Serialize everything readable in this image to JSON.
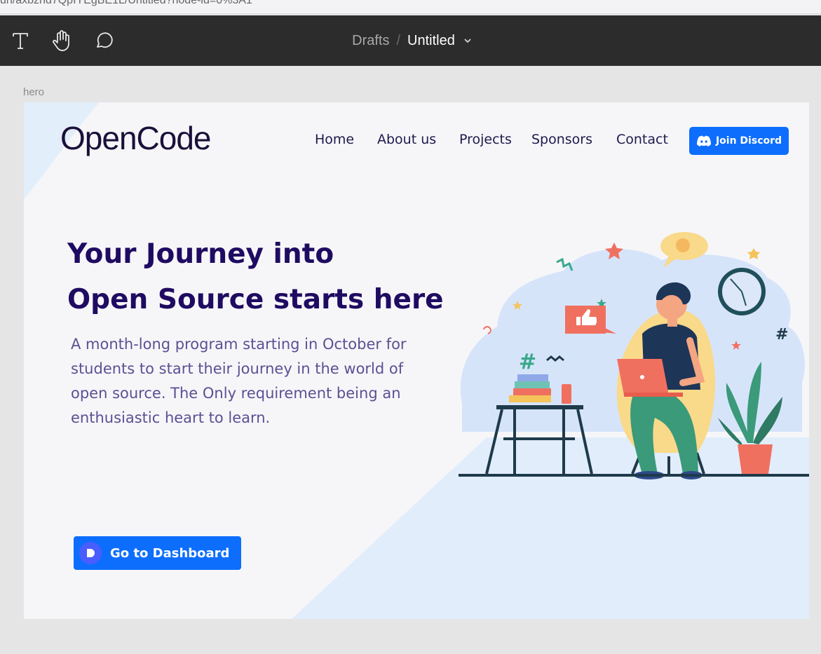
{
  "browser": {
    "url_fragment": "un/axbzhd7QpIYEgBE1L/Untitled?node-id=0%3A1"
  },
  "toolbar": {
    "tools": [
      {
        "name": "text-tool",
        "icon": "text-icon"
      },
      {
        "name": "hand-tool",
        "icon": "hand-icon"
      },
      {
        "name": "comment-tool",
        "icon": "comment-icon"
      }
    ],
    "breadcrumb": {
      "folder": "Drafts",
      "separator": "/",
      "file": "Untitled"
    }
  },
  "frame": {
    "label": "hero"
  },
  "site": {
    "logo": "OpenCode",
    "nav": [
      "Home",
      "About us",
      "Projects",
      "Sponsors",
      "Contact"
    ],
    "discord_button": "Join Discord",
    "hero_title_line1": "Your Journey into",
    "hero_title_line2": "Open Source starts here",
    "hero_description": "A month-long program starting in October for students to start their journey in the world of open source. The Only requirement being an enthusiastic heart to learn.",
    "dashboard_button": "Go to Dashboard",
    "colors": {
      "primary": "#0d6efd",
      "title": "#1f0b61",
      "body_text": "#5d4f92",
      "frame_bg": "#f6f6f9",
      "accent_bg": "#e1edfb"
    }
  }
}
